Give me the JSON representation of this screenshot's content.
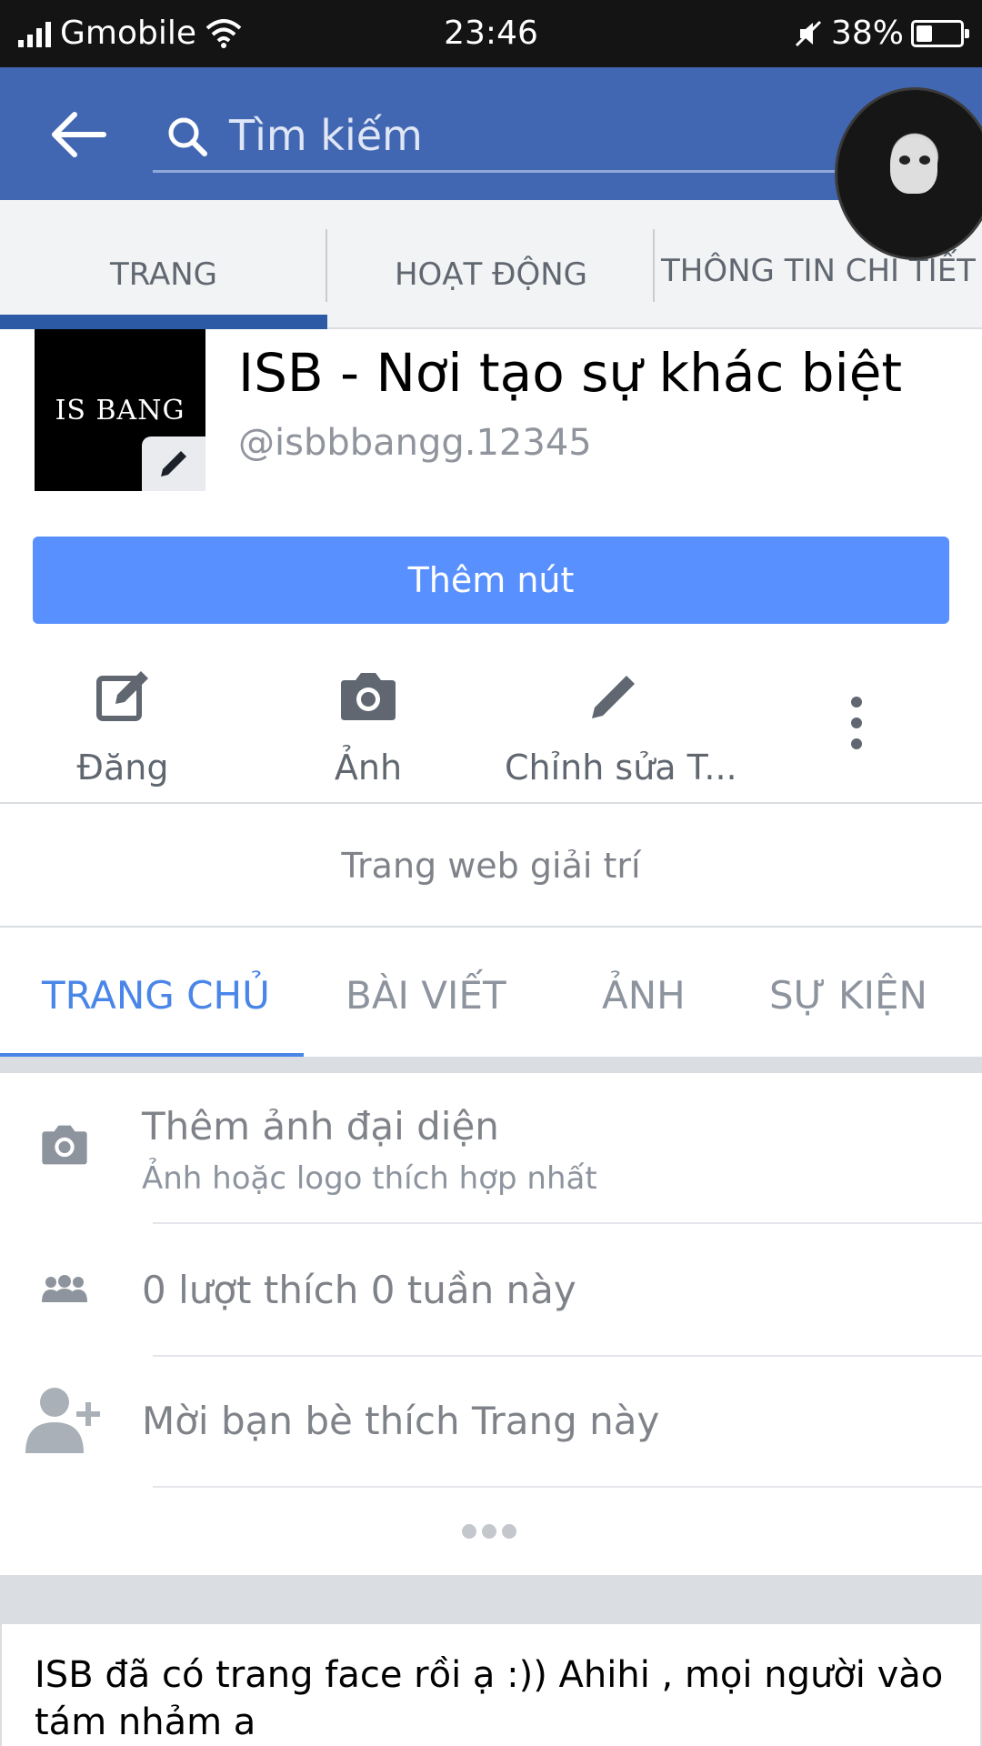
{
  "status_bar": {
    "carrier": "Gmobile",
    "time": "23:46",
    "battery": "38%",
    "battery_level": 0.38
  },
  "header": {
    "search_placeholder": "Tìm kiếm"
  },
  "top_tabs": [
    "TRANG",
    "HOẠT ĐỘNG",
    "THÔNG TIN CHI TIẾT"
  ],
  "page": {
    "logo_text": "IS BANG",
    "name": "ISB - Nơi tạo sự khác biệt",
    "handle": "@isbbbangg.12345"
  },
  "add_button": "Thêm nút",
  "actions": {
    "post": "Đăng",
    "photo": "Ảnh",
    "edit": "Chỉnh sửa T..."
  },
  "category": "Trang web giải trí",
  "section_tabs": [
    "TRANG CHỦ",
    "BÀI VIẾT",
    "ẢNH",
    "SỰ KIỆN"
  ],
  "list": {
    "profile_photo_title": "Thêm ảnh đại diện",
    "profile_photo_sub": "Ảnh hoặc logo thích hợp nhất",
    "likes": "0 lượt thích 0 tuần này",
    "invite": "Mời bạn bè thích Trang này"
  },
  "post": {
    "text": "ISB đã có trang face rồi ạ :)) Ahihi , mọi người vào tám nhảm a"
  }
}
